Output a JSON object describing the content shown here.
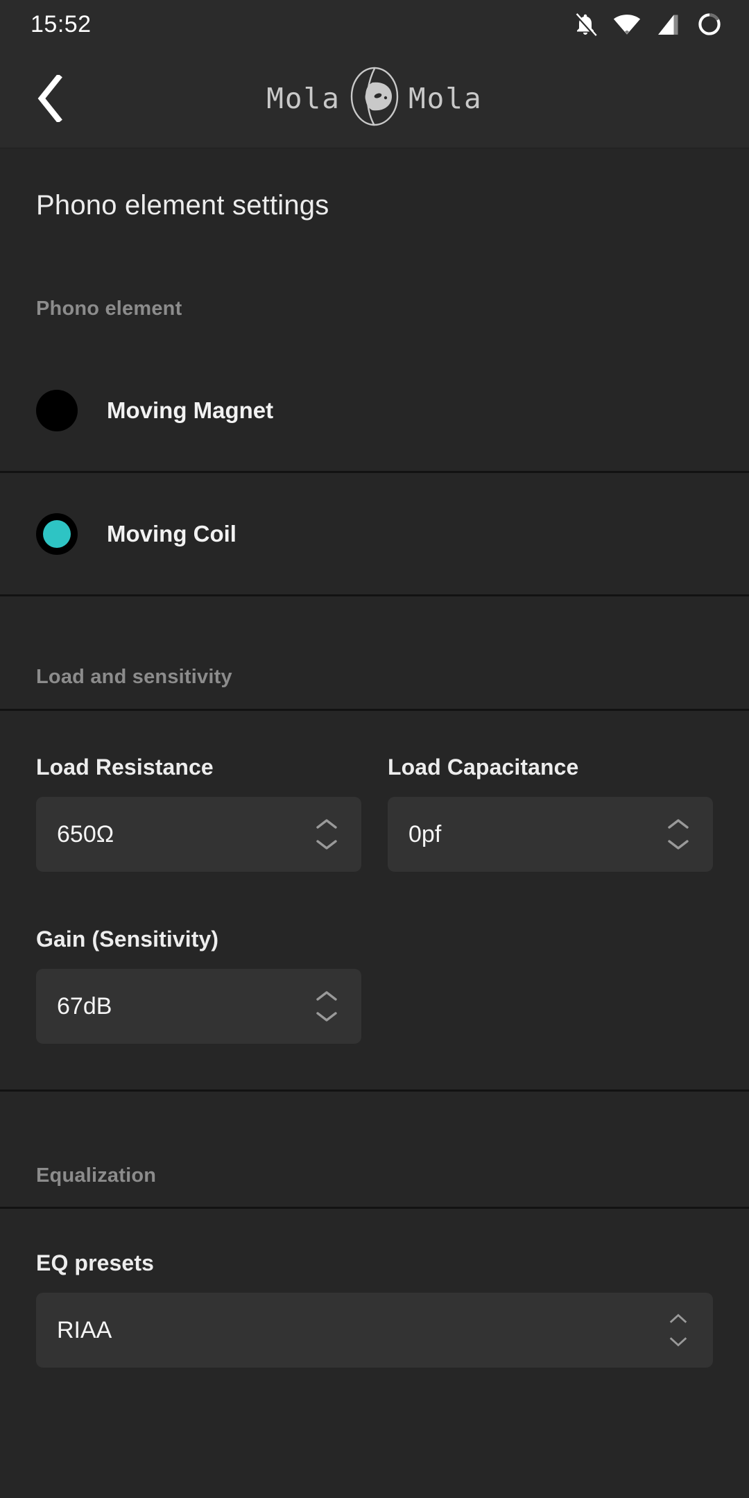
{
  "status_bar": {
    "time": "15:52",
    "icons": [
      {
        "name": "notifications-off-icon"
      },
      {
        "name": "wifi-icon"
      },
      {
        "name": "cellular-signal-icon"
      },
      {
        "name": "battery-circle-icon"
      }
    ]
  },
  "app_bar": {
    "back_label": "‹",
    "logo_left": "Mola",
    "logo_right": "Mola",
    "logo_mark": "sunfish-logo-icon"
  },
  "page": {
    "title": "Phono element settings"
  },
  "sections": {
    "phono_element": {
      "header": "Phono element",
      "options": [
        {
          "label": "Moving Magnet",
          "selected": false
        },
        {
          "label": "Moving Coil",
          "selected": true
        }
      ]
    },
    "load_and_sensitivity": {
      "header": "Load and sensitivity",
      "fields": [
        {
          "label": "Load Resistance",
          "value": "650Ω"
        },
        {
          "label": "Load Capacitance",
          "value": "0pf"
        },
        {
          "label": "Gain (Sensitivity)",
          "value": "67dB"
        }
      ]
    },
    "equalization": {
      "header": "Equalization",
      "fields": [
        {
          "label": "EQ presets",
          "value": "RIAA"
        }
      ]
    }
  },
  "colors": {
    "accent": "#2ec4c4",
    "background": "#262626",
    "surface": "#2b2b2b",
    "field": "#333333",
    "divider": "#121212",
    "text_primary": "#f2f2f2",
    "text_muted": "#8c8c8c"
  }
}
